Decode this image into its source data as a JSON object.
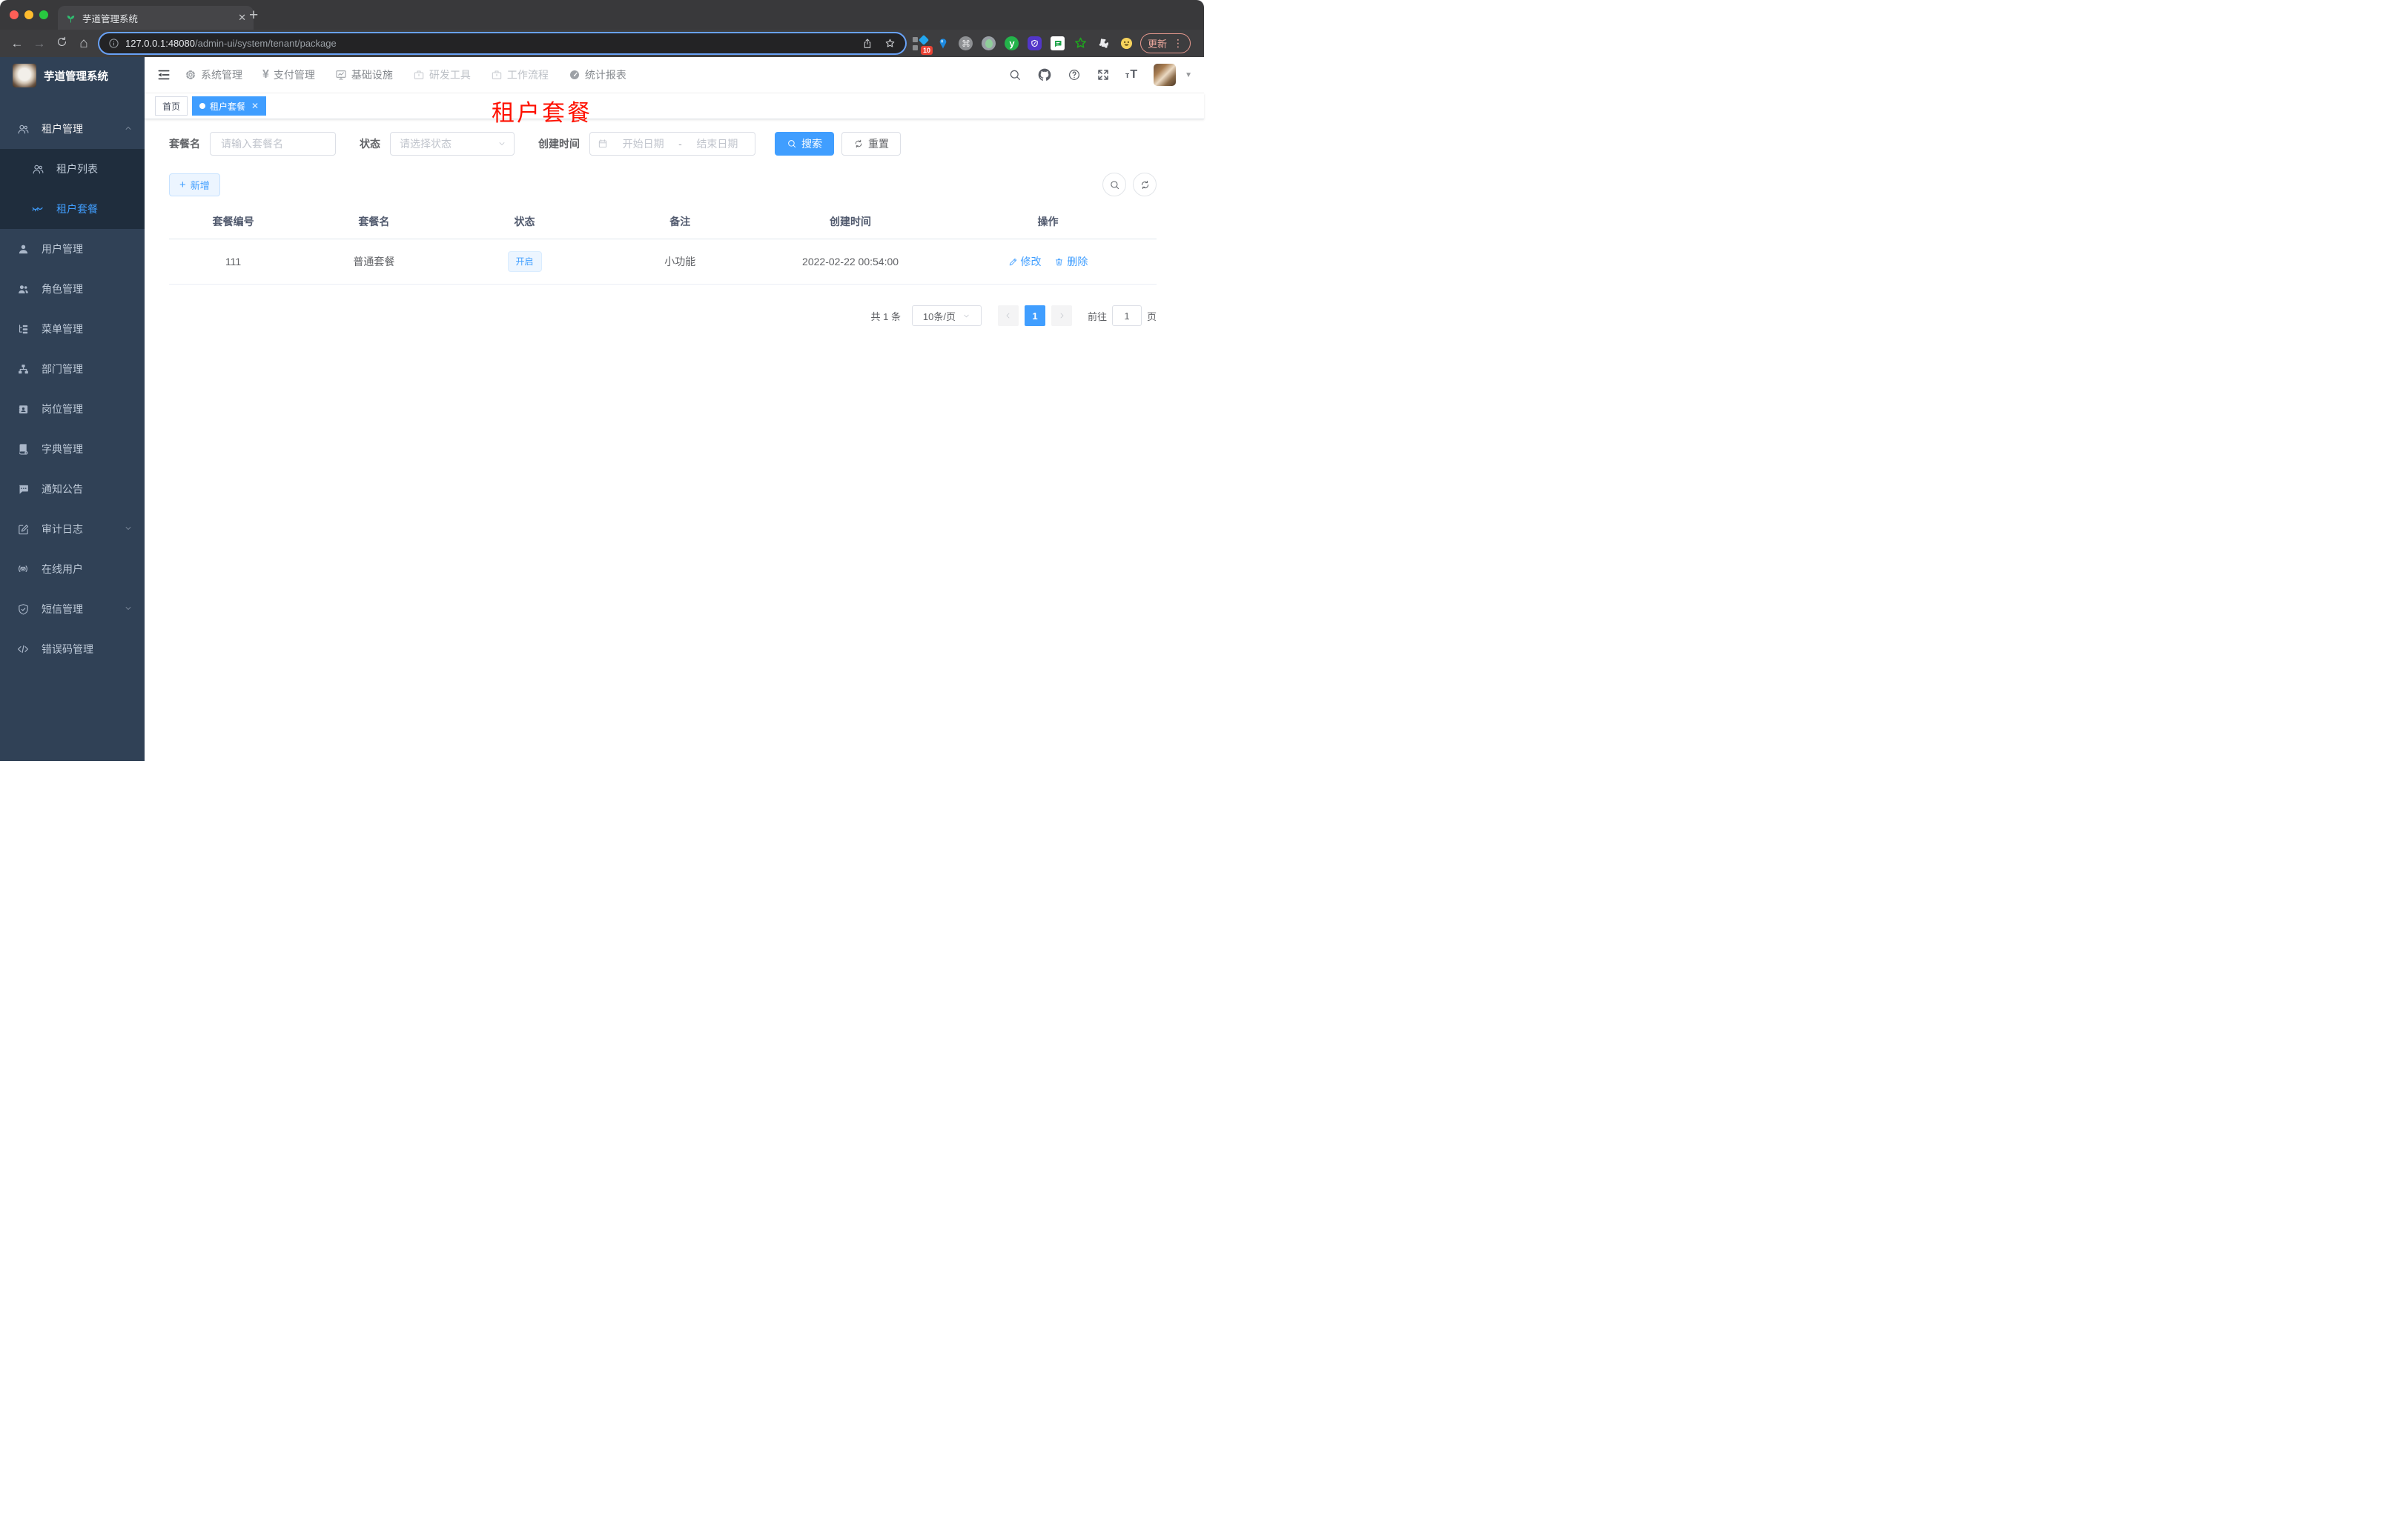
{
  "browser": {
    "tab_title": "芋道管理系统",
    "favicon": "sprout-icon",
    "url_host": "127.0.0.1:48080",
    "url_path": "/admin-ui/system/tenant/package",
    "extension_badge": "10",
    "update_label": "更新"
  },
  "sidebar": {
    "logo_title": "芋道管理系统",
    "items": [
      {
        "label": "租户管理",
        "icon": "people-icon",
        "state": "expanded"
      },
      {
        "label": "租户列表",
        "icon": "people-icon",
        "level": 2
      },
      {
        "label": "租户套餐",
        "icon": "eye-closed-icon",
        "level": 2,
        "active": true
      },
      {
        "label": "用户管理",
        "icon": "user-icon"
      },
      {
        "label": "角色管理",
        "icon": "people-icon"
      },
      {
        "label": "菜单管理",
        "icon": "tree-icon"
      },
      {
        "label": "部门管理",
        "icon": "org-icon"
      },
      {
        "label": "岗位管理",
        "icon": "badge-icon"
      },
      {
        "label": "字典管理",
        "icon": "book-icon"
      },
      {
        "label": "通知公告",
        "icon": "chat-icon"
      },
      {
        "label": "审计日志",
        "icon": "note-icon",
        "state": "collapsed"
      },
      {
        "label": "在线用户",
        "icon": "signal-icon"
      },
      {
        "label": "短信管理",
        "icon": "shield-icon",
        "state": "collapsed"
      },
      {
        "label": "错误码管理",
        "icon": "code-icon"
      }
    ]
  },
  "topnav": {
    "items": [
      {
        "label": "系统管理",
        "icon": "gear-icon"
      },
      {
        "label": "支付管理",
        "icon": "yen-icon"
      },
      {
        "label": "基础设施",
        "icon": "monitor-icon"
      },
      {
        "label": "研发工具",
        "icon": "briefcase-icon",
        "muted": true
      },
      {
        "label": "工作流程",
        "icon": "briefcase-icon",
        "muted": true
      },
      {
        "label": "统计报表",
        "icon": "gauge-icon"
      }
    ]
  },
  "tags": {
    "home": "首页",
    "active": "租户套餐"
  },
  "page_title": "租户套餐",
  "filters": {
    "name_label": "套餐名",
    "name_placeholder": "请输入套餐名",
    "status_label": "状态",
    "status_placeholder": "请选择状态",
    "date_label": "创建时间",
    "date_start_placeholder": "开始日期",
    "date_separator": "-",
    "date_end_placeholder": "结束日期",
    "search_label": "搜索",
    "reset_label": "重置"
  },
  "toolbar": {
    "add_label": "新增"
  },
  "table": {
    "columns": [
      "套餐编号",
      "套餐名",
      "状态",
      "备注",
      "创建时间",
      "操作"
    ],
    "rows": [
      {
        "id": "111",
        "name": "普通套餐",
        "status": "开启",
        "remark": "小功能",
        "created": "2022-02-22 00:54:00",
        "edit_label": "修改",
        "delete_label": "删除"
      }
    ]
  },
  "pagination": {
    "total": "共 1 条",
    "page_size": "10条/页",
    "current_page": "1",
    "goto_prefix": "前往",
    "goto_value": "1",
    "goto_suffix": "页"
  },
  "colors": {
    "accent": "#409eff",
    "sidebar_bg": "#304156",
    "submenu_bg": "#1f2d3d",
    "page_title_red": "#fe1000",
    "status_tag_bg": "#ecf5ff"
  }
}
